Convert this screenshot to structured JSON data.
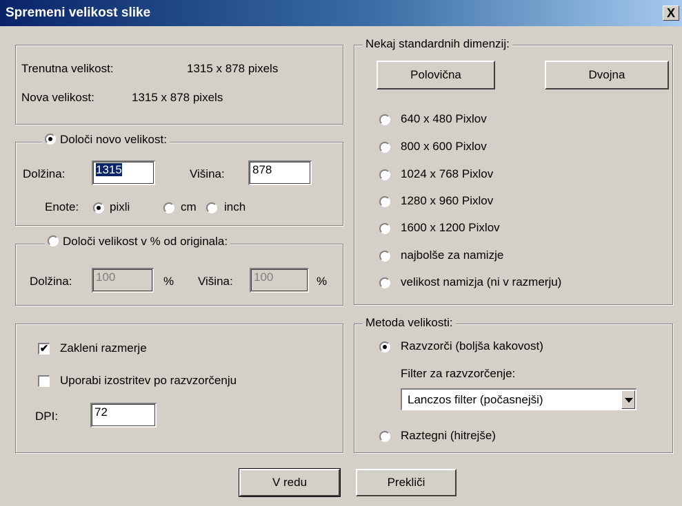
{
  "window": {
    "title": "Spremeni velikost slike",
    "close_label": "X"
  },
  "info": {
    "current_label": "Trenutna velikost:",
    "current_value": "1315  x  878  pixels",
    "new_label": "Nova velikost:",
    "new_value": "1315  x  878  pixels"
  },
  "new_size": {
    "legend": "Določi novo velikost:",
    "checked": true,
    "width_label": "Dolžina:",
    "width_value": "1315",
    "height_label": "Višina:",
    "height_value": "878",
    "units_label": "Enote:",
    "units": [
      {
        "label": "pixli",
        "checked": true
      },
      {
        "label": "cm",
        "checked": false
      },
      {
        "label": "inch",
        "checked": false
      }
    ]
  },
  "percent": {
    "legend": "Določi velikost v % od originala:",
    "checked": false,
    "width_label": "Dolžina:",
    "width_value": "100",
    "pct1": "%",
    "height_label": "Višina:",
    "height_value": "100",
    "pct2": "%"
  },
  "options": {
    "lock_label": "Zakleni razmerje",
    "lock_checked": true,
    "sharpen_label": "Uporabi izostritev po razvzorčenju",
    "sharpen_checked": false,
    "dpi_label": "DPI:",
    "dpi_value": "72"
  },
  "standard": {
    "legend": "Nekaj standardnih dimenzij:",
    "half_label": "Polovična",
    "double_label": "Dvojna",
    "options": [
      "640 x 480 Pixlov",
      "800 x 600 Pixlov",
      "1024 x 768 Pixlov",
      "1280 x 960 Pixlov",
      "1600 x 1200 Pixlov",
      "najbolše za namizje",
      "velikost namizja (ni v razmerju)"
    ]
  },
  "method": {
    "legend": "Metoda velikosti:",
    "resample_label": "Razvzorči (boljša kakovost)",
    "resample_checked": true,
    "filter_label": "Filter za razvzorčenje:",
    "filter_value": "Lanczos filter (počasnejši)",
    "stretch_label": "Raztegni (hitrejše)",
    "stretch_checked": false
  },
  "footer": {
    "ok_label": "V redu",
    "cancel_label": "Prekliči"
  }
}
